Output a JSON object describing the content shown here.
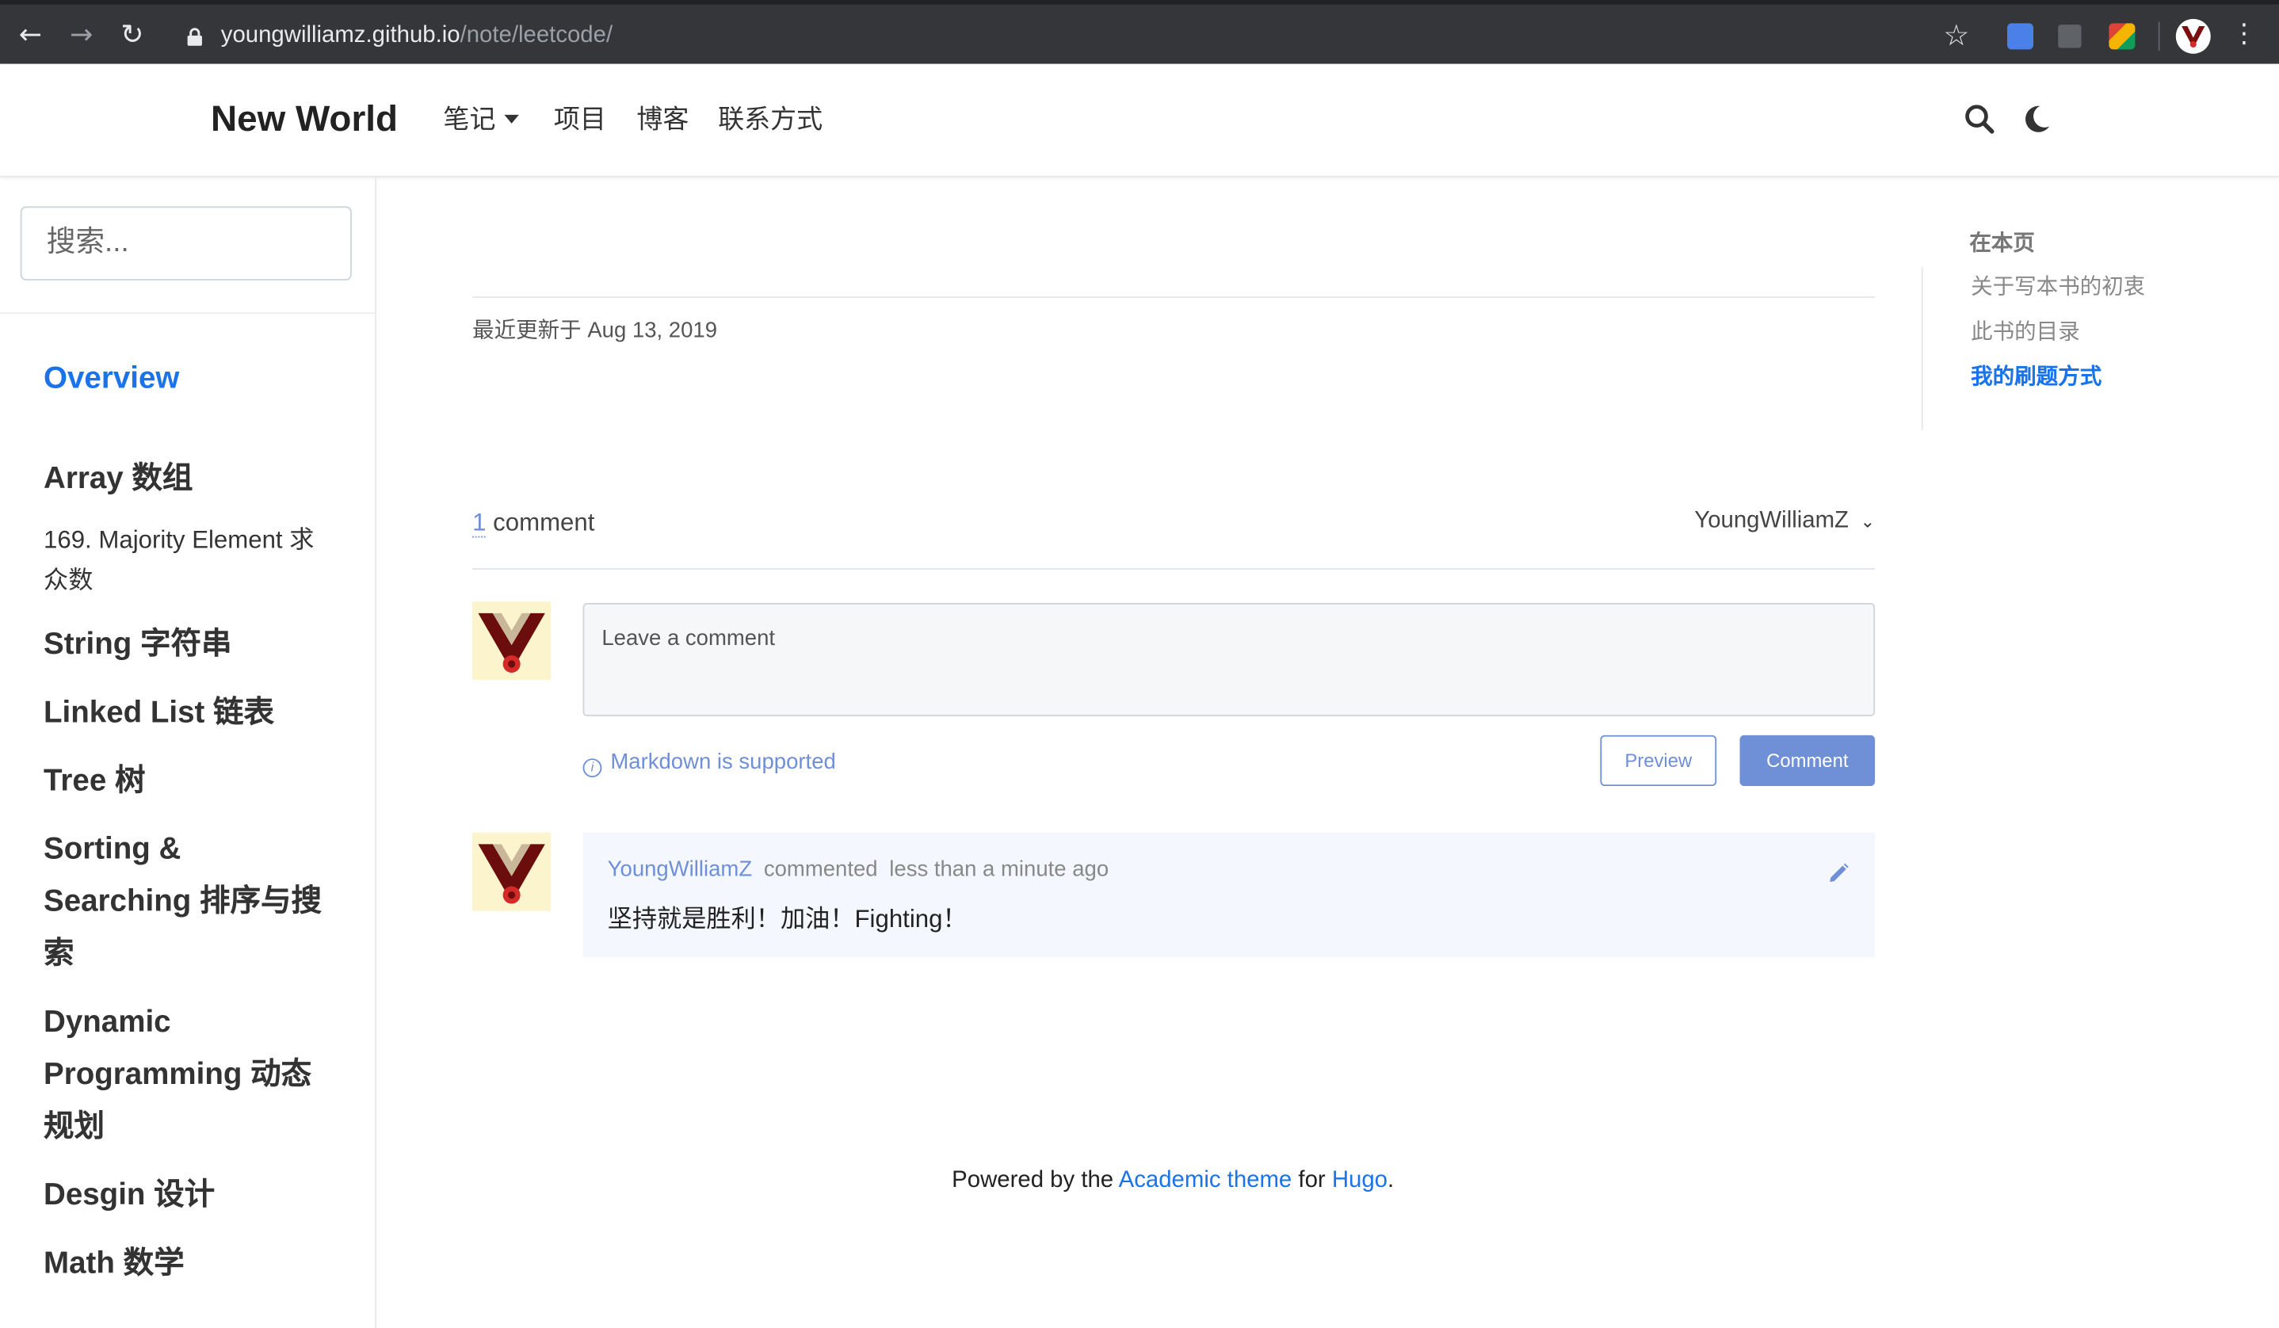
{
  "browser": {
    "url_host": "youngwilliamz.github.io",
    "url_path": "/note/leetcode/"
  },
  "navbar": {
    "brand": "New World",
    "links": [
      "笔记",
      "项目",
      "博客",
      "联系方式"
    ],
    "icons": [
      "search-icon",
      "moon-icon"
    ]
  },
  "sidebar": {
    "search_placeholder": "搜索...",
    "overview": "Overview",
    "sections": [
      {
        "title": "Array 数组",
        "items": [
          "169. Majority Element 求众数"
        ]
      },
      {
        "title": "String 字符串"
      },
      {
        "title": "Linked List 链表"
      },
      {
        "title": "Tree 树"
      },
      {
        "title": "Sorting & Searching 排序与搜索"
      },
      {
        "title": "Dynamic Programming 动态规划"
      },
      {
        "title": "Desgin 设计"
      },
      {
        "title": "Math 数学"
      }
    ]
  },
  "main": {
    "last_updated": "最近更新于 Aug 13, 2019"
  },
  "comments": {
    "count": "1",
    "count_label": "comment",
    "current_user": "YoungWilliamZ",
    "input_placeholder": "Leave a comment",
    "markdown_note": "Markdown is supported",
    "preview_label": "Preview",
    "comment_label": "Comment",
    "items": [
      {
        "author": "YoungWilliamZ",
        "action": "commented",
        "time": "less than a minute ago",
        "body": "坚持就是胜利！加油！Fighting！"
      }
    ]
  },
  "footer": {
    "prefix": "Powered by the",
    "theme_link": "Academic theme",
    "middle": "for",
    "hugo_link": "Hugo",
    "suffix": "."
  },
  "toc": {
    "title": "在本页",
    "items": [
      "关于写本书的初衷",
      "此书的目录",
      "我的刷题方式"
    ],
    "active_index": 2
  },
  "colors": {
    "accent": "#1a73e8",
    "comment_accent": "#6f8fd6",
    "chrome": "#35363a"
  }
}
